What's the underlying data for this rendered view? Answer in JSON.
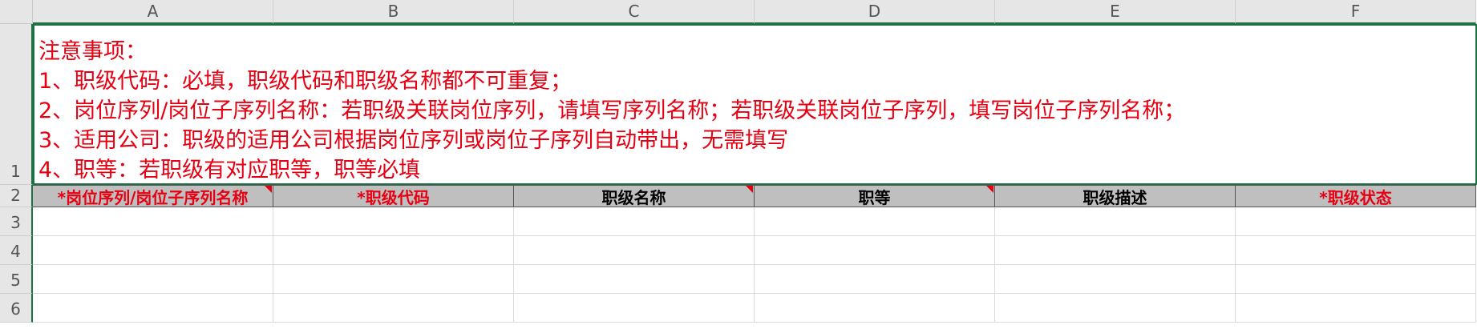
{
  "columns": [
    "A",
    "B",
    "C",
    "D",
    "E",
    "F"
  ],
  "rows": [
    "1",
    "2",
    "3",
    "4",
    "5",
    "6"
  ],
  "notes": {
    "title": "注意事项：",
    "line1": "1、职级代码：必填，职级代码和职级名称都不可重复；",
    "line2": "2、岗位序列/岗位子序列名称：若职级关联岗位序列，请填写序列名称；若职级关联岗位子序列，填写岗位子序列名称；",
    "line3": "3、适用公司：职级的适用公司根据岗位序列或岗位子序列自动带出，无需填写",
    "line4": "4、职等：若职级有对应职等，职等必填"
  },
  "table_headers": [
    {
      "label": "*岗位序列/岗位子序列名称",
      "required": true,
      "comment": true
    },
    {
      "label": "*职级代码",
      "required": true,
      "comment": false
    },
    {
      "label": "职级名称",
      "required": false,
      "comment": true
    },
    {
      "label": "职等",
      "required": false,
      "comment": true
    },
    {
      "label": "职级描述",
      "required": false,
      "comment": false
    },
    {
      "label": "*职级状态",
      "required": true,
      "comment": false
    }
  ],
  "colors": {
    "required_text": "#e60012",
    "header_fill": "#bfbfbf",
    "selection_border": "#1e7145"
  }
}
